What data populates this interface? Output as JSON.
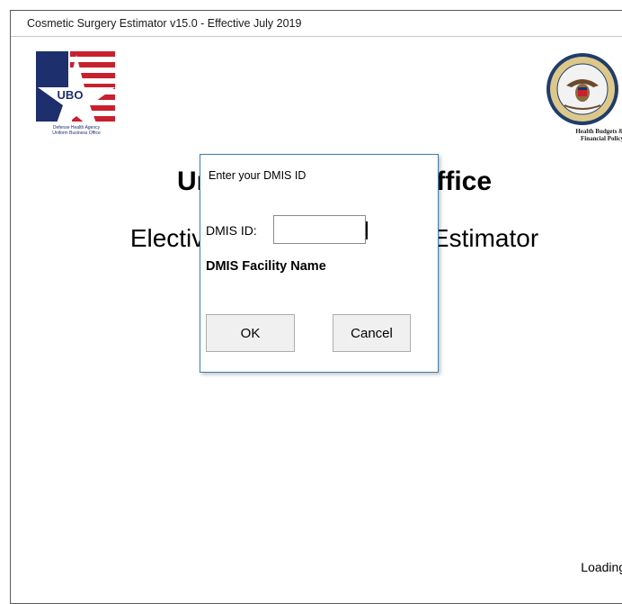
{
  "window": {
    "title": "Cosmetic Surgery Estimator v15.0 - Effective July 2019"
  },
  "logos": {
    "ubo": {
      "text": "UBO",
      "caption_line1": "Defense Health Agency",
      "caption_line2": "Uniform Business Office"
    },
    "dod": {
      "seal_top": "DEPARTMENT OF DEFENSE",
      "seal_bottom": "UNITED STATES OF AMERICA",
      "caption": "Health Budgets &\nFinancial Policy"
    }
  },
  "main": {
    "heading": "Uniform Business Office",
    "subheading": "Elective Cosmetic Surgery Estimator",
    "status": "Loading."
  },
  "dialog": {
    "title": "Enter your DMIS ID",
    "dmis_label": "DMIS ID:",
    "dmis_value": "",
    "facility_label": "DMIS Facility Name",
    "ok_label": "OK",
    "cancel_label": "Cancel"
  },
  "colors": {
    "ubo_red": "#c8202f",
    "ubo_navy": "#1e2f6e",
    "dialog_border": "#3c7fb1"
  }
}
